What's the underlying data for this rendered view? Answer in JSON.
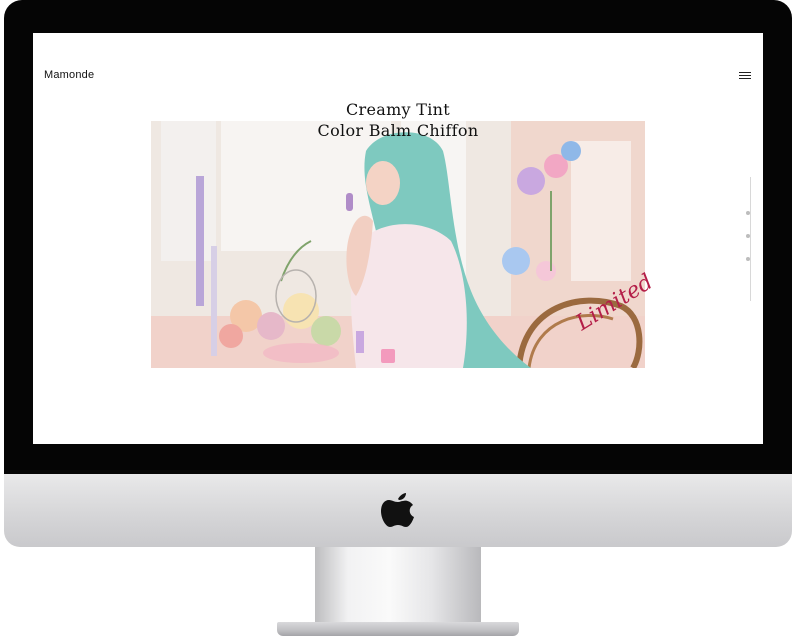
{
  "site": {
    "brand": "Mamonde",
    "hero": {
      "title_line1": "Creamy Tint",
      "title_line2": "Color Balm Chiffon",
      "signature": "Limited"
    },
    "pagination": {
      "count": 3,
      "active": 1
    },
    "icons": [
      "hamburger-menu-icon",
      "apple-logo-icon"
    ],
    "colors": {
      "bezel": "#050505",
      "accent": "#b41e48",
      "hair": "#7ec9bf"
    }
  }
}
